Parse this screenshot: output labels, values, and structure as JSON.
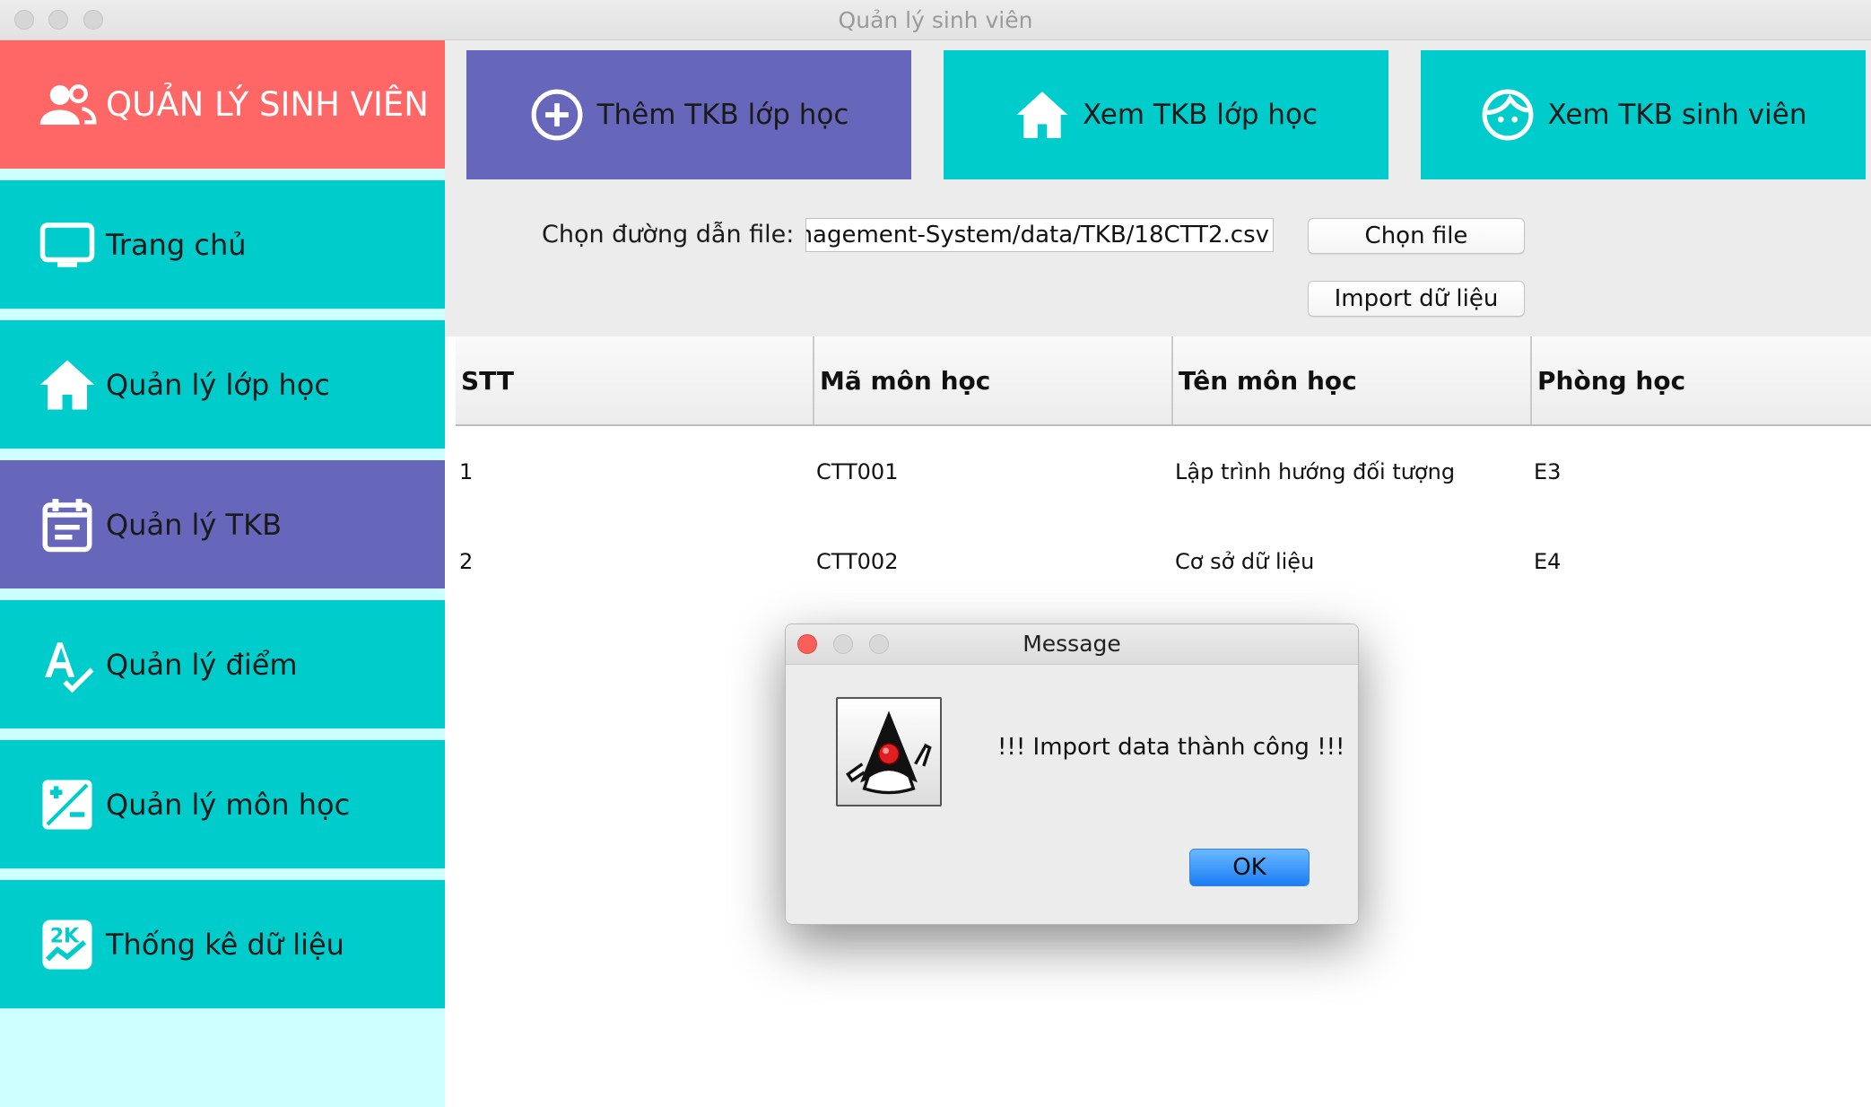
{
  "window": {
    "title": "Quản lý sinh viên"
  },
  "sidebar": {
    "header": {
      "label": "QUẢN LÝ SINH VIÊN",
      "icon": "users-icon"
    },
    "items": [
      {
        "label": "Trang chủ",
        "icon": "monitor-icon"
      },
      {
        "label": "Quản lý lớp học",
        "icon": "home-icon"
      },
      {
        "label": "Quản lý TKB",
        "icon": "calendar-icon",
        "active": true
      },
      {
        "label": "Quản lý điểm",
        "icon": "spellcheck-icon"
      },
      {
        "label": "Quản lý môn học",
        "icon": "plus-minus-icon"
      },
      {
        "label": "Thống kê dữ liệu",
        "icon": "chart-2k-icon"
      }
    ]
  },
  "toolbar": {
    "add_label": "Thêm TKB lớp học",
    "view_class_label": "Xem TKB lớp học",
    "view_student_label": "Xem TKB sinh viên",
    "path_label": "Chọn đường dẫn file:",
    "path_value": "nagement-System/data/TKB/18CTT2.csv",
    "choose_file_label": "Chọn file",
    "import_label": "Import dữ liệu"
  },
  "table": {
    "columns": [
      "STT",
      "Mã môn học",
      "Tên môn học",
      "Phòng học"
    ],
    "rows": [
      [
        "1",
        "CTT001",
        "Lập trình hướng đối tượng",
        "E3"
      ],
      [
        "2",
        "CTT002",
        "Cơ sở dữ liệu",
        "E4"
      ]
    ]
  },
  "dialog": {
    "title": "Message",
    "message": "!!! Import data thành công !!!",
    "ok_label": "OK",
    "icon": "java-duke-icon"
  },
  "colors": {
    "header_red": "#ff6666",
    "teal": "#00cccc",
    "purple": "#6666bb",
    "sidebar_bg": "#ccfffe"
  }
}
